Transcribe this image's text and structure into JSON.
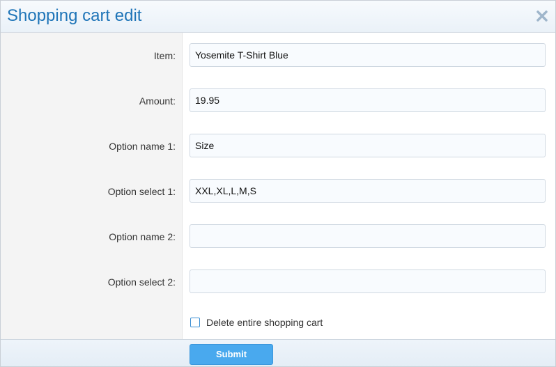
{
  "dialog": {
    "title": "Shopping cart edit",
    "close_icon": "close-icon"
  },
  "form": {
    "fields": [
      {
        "label": "Item:",
        "value": "Yosemite T-Shirt Blue"
      },
      {
        "label": "Amount:",
        "value": "19.95"
      },
      {
        "label": "Option name 1:",
        "value": "Size"
      },
      {
        "label": "Option select 1:",
        "value": "XXL,XL,L,M,S"
      },
      {
        "label": "Option name 2:",
        "value": ""
      },
      {
        "label": "Option select 2:",
        "value": ""
      }
    ],
    "delete_checkbox": {
      "label": "Delete entire shopping cart",
      "checked": false
    }
  },
  "footer": {
    "submit_label": "Submit"
  },
  "colors": {
    "title": "#1f75b8",
    "accent": "#49a9ee"
  }
}
